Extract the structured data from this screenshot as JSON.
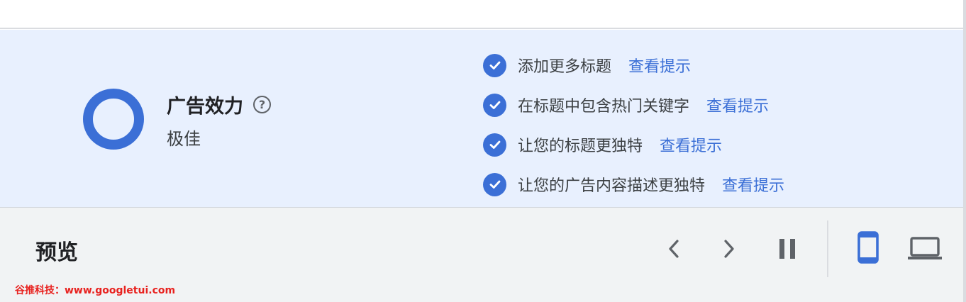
{
  "ad_strength": {
    "title": "广告效力",
    "rating": "极佳",
    "help_glyph": "?",
    "ring_color": "#3b6fd6",
    "tips": [
      {
        "text": "添加更多标题",
        "link": "查看提示"
      },
      {
        "text": "在标题中包含热门关键字",
        "link": "查看提示"
      },
      {
        "text": "让您的标题更独特",
        "link": "查看提示"
      },
      {
        "text": "让您的广告内容描述更独特",
        "link": "查看提示"
      }
    ]
  },
  "preview": {
    "title": "预览",
    "controls": [
      "chevron-left-icon",
      "chevron-right-icon",
      "pause-icon",
      "mobile-device-icon",
      "laptop-device-icon"
    ],
    "active_device": "mobile"
  },
  "watermark": "谷推科技：www.googletui.com",
  "colors": {
    "accent": "#3b6fd6",
    "panel_bg": "#e8f0fe",
    "bar_bg": "#f1f3f4",
    "watermark": "#e8221f"
  }
}
